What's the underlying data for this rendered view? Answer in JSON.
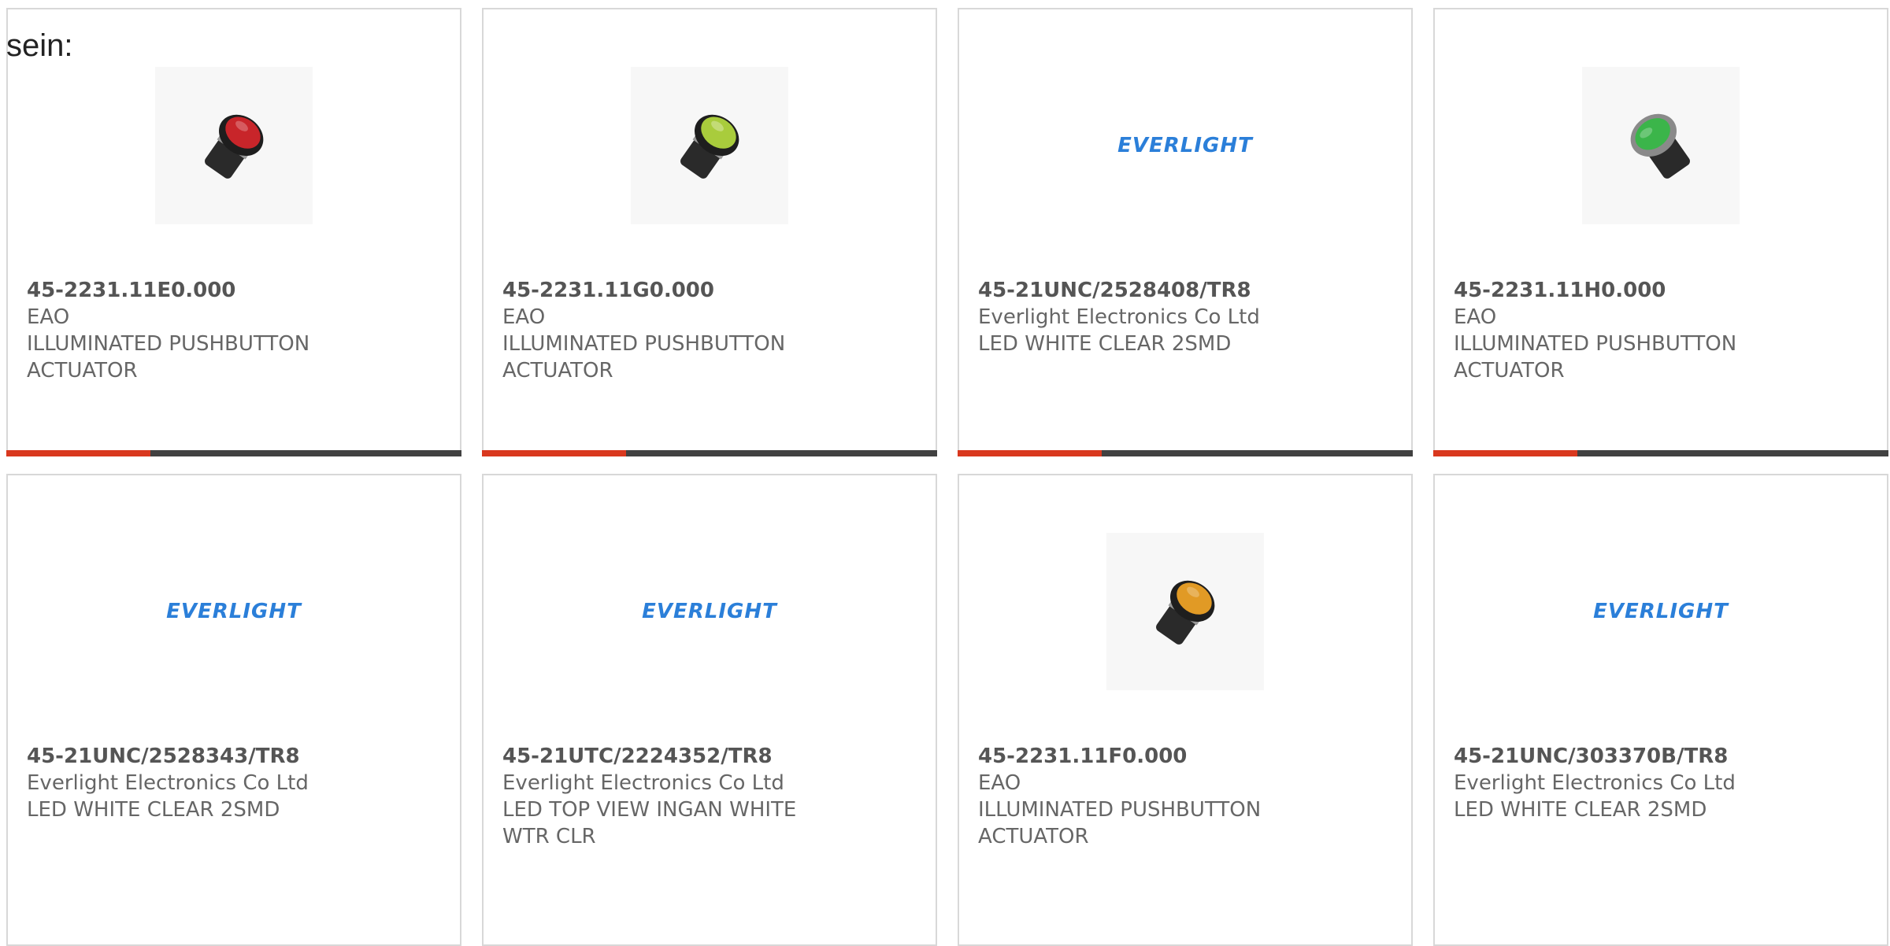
{
  "intro_text": "sein:",
  "products": [
    {
      "part": "45-2231.11E0.000",
      "maker": "EAO",
      "desc": "ILLUMINATED PUSHBUTTON ACTUATOR",
      "image": "red-pushbutton",
      "cap_color": "#c8252a"
    },
    {
      "part": "45-2231.11G0.000",
      "maker": "EAO",
      "desc": "ILLUMINATED PUSHBUTTON ACTUATOR",
      "image": "yellow-pushbutton",
      "cap_color": "#a9cc3c"
    },
    {
      "part": "45-21UNC/2528408/TR8",
      "maker": "Everlight Electronics Co Ltd",
      "desc": "LED WHITE CLEAR 2SMD",
      "image": "everlight-logo",
      "logo": "EVERLIGHT"
    },
    {
      "part": "45-2231.11H0.000",
      "maker": "EAO",
      "desc": "ILLUMINATED PUSHBUTTON ACTUATOR",
      "image": "green-pushbutton",
      "cap_color": "#3bb54a"
    },
    {
      "part": "45-21UNC/2528343/TR8",
      "maker": "Everlight Electronics Co Ltd",
      "desc": "LED WHITE CLEAR 2SMD",
      "image": "everlight-logo",
      "logo": "EVERLIGHT"
    },
    {
      "part": "45-21UTC/2224352/TR8",
      "maker": "Everlight Electronics Co Ltd",
      "desc": "LED TOP VIEW INGAN WHITE WTR CLR",
      "image": "everlight-logo",
      "logo": "EVERLIGHT"
    },
    {
      "part": "45-2231.11F0.000",
      "maker": "EAO",
      "desc": "ILLUMINATED PUSHBUTTON ACTUATOR",
      "image": "amber-pushbutton",
      "cap_color": "#e19a25"
    },
    {
      "part": "45-21UNC/303370B/TR8",
      "maker": "Everlight Electronics Co Ltd",
      "desc": "LED WHITE CLEAR 2SMD",
      "image": "everlight-logo",
      "logo": "EVERLIGHT"
    }
  ],
  "colors": {
    "accent": "#d9381e",
    "bar": "#414141",
    "border": "#d8d8d8",
    "logo": "#2b7fd9"
  }
}
